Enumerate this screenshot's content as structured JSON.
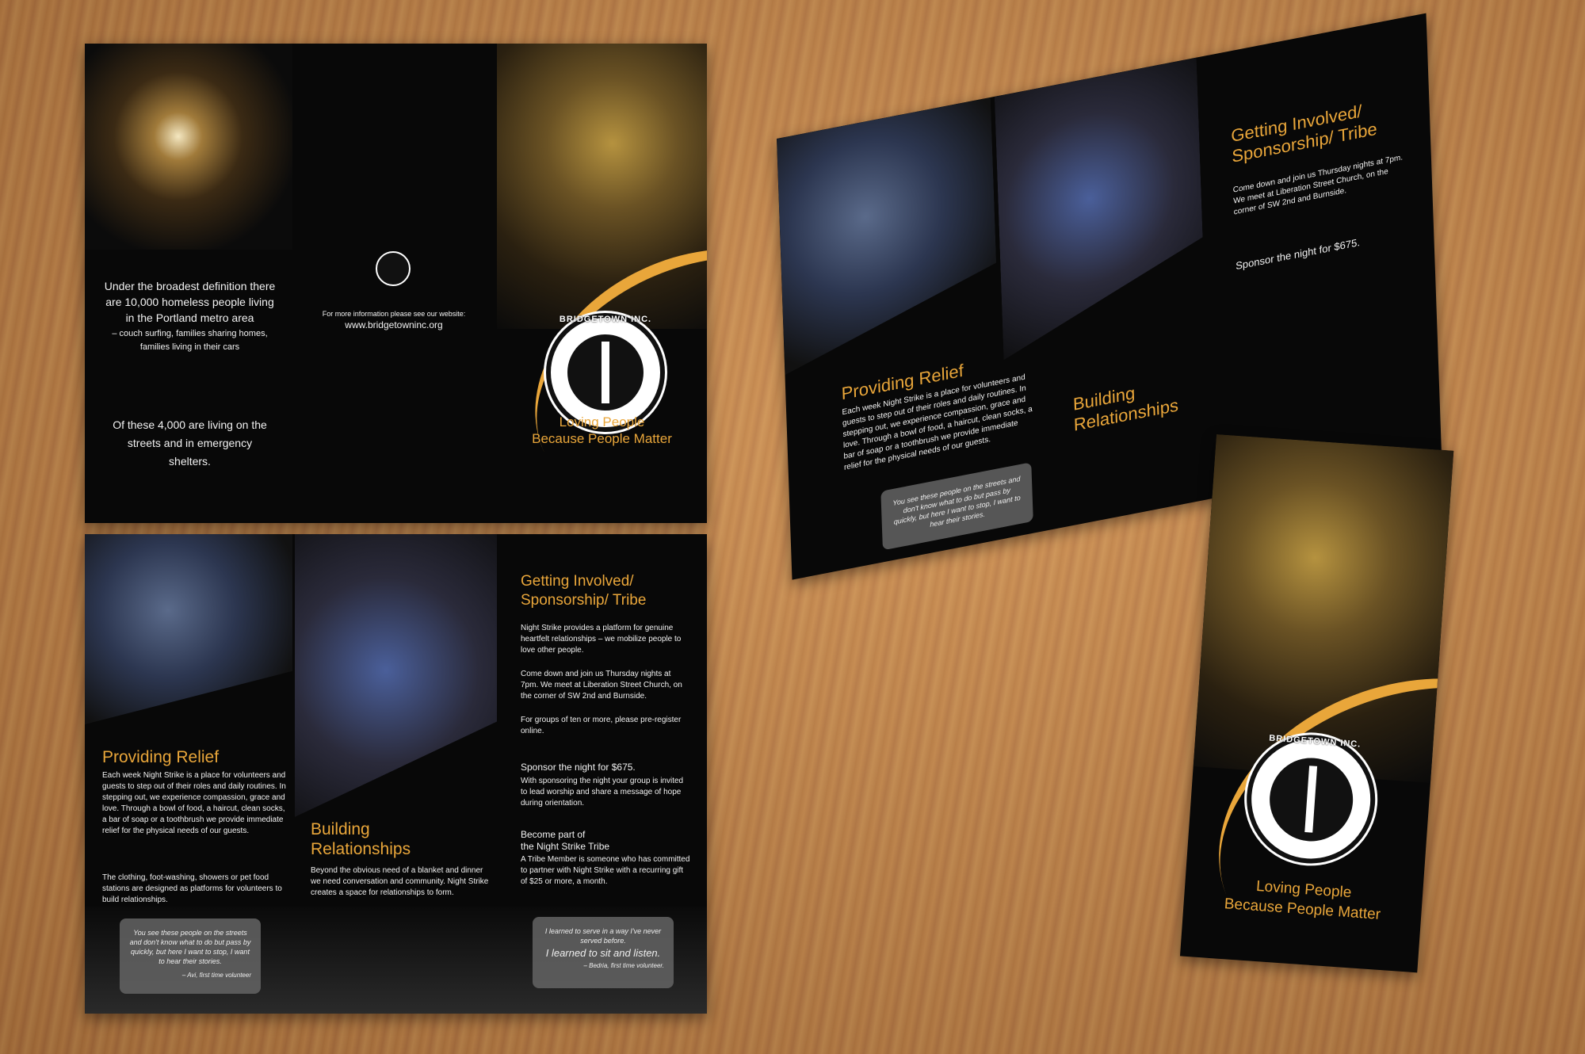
{
  "cover": {
    "stat_intro": "Under the broadest definition there are 10,000 homeless people living in the Portland metro area",
    "stat_detail": "– couch surfing, families sharing homes, families living in their cars",
    "stat_streets": "Of these 4,000 are living on the streets and in emergency shelters.",
    "info_label": "For more information please see our website:",
    "website": "www.bridgetowninc.org",
    "tagline_1": "Loving People",
    "tagline_2": "Because People Matter",
    "logo_title": "BRIDGETOWN INC.",
    "logo_motto": "LOVING PEOPLE, BECAUSE PEOPLE MATTER"
  },
  "inside": {
    "relief_title": "Providing Relief",
    "relief_body_1": "Each week Night Strike is a place for volunteers and guests to step out of their roles and daily routines. In stepping out, we experience compassion, grace and love. Through a bowl of food, a haircut, clean socks, a bar of soap or a toothbrush we provide immediate relief for the physical needs of our guests.",
    "relief_body_2": "The clothing, foot-washing, showers or pet food stations are designed as platforms for volunteers to build relationships.",
    "relationships_title_1": "Building",
    "relationships_title_2": "Relationships",
    "relationships_body": "Beyond the obvious need of a blanket and dinner we need conversation and community. Night Strike creates a space for relationships to form.",
    "involved_title_1": "Getting Involved/",
    "involved_title_2": "Sponsorship/ Tribe",
    "involved_body_1": "Night Strike provides a platform for genuine heartfelt relationships – we mobilize people to love other people.",
    "involved_body_2": "Come down and join us Thursday nights at 7pm. We meet at Liberation Street Church, on the corner of SW 2nd and Burnside.",
    "involved_body_3": "For groups of ten or more, please pre-register online.",
    "sponsor_title": "Sponsor the night for $675.",
    "sponsor_body": "With sponsoring the night your group is invited to lead worship and share a message of hope during orientation.",
    "tribe_title_1": "Become part of",
    "tribe_title_2": "the Night Strike Tribe",
    "tribe_body": "A Tribe Member is someone who has committed to partner with Night Strike with a recurring gift of $25 or more, a month.",
    "quote1_text": "You see these people on the streets and don't know what to do but pass by quickly, but here I want to stop, I want to hear their stories.",
    "quote1_author": "– Avi, first time volunteer",
    "quote2_line1": "I learned to serve in a way I've never served before.",
    "quote2_line2": "I learned to sit and listen.",
    "quote2_author": "– Bedria, first time volunteer."
  }
}
